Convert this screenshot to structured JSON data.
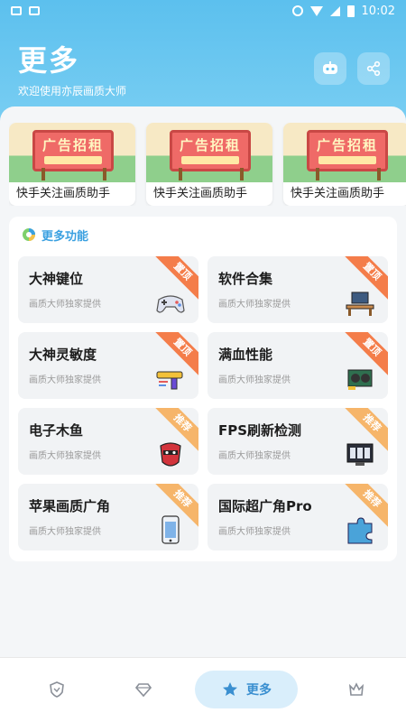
{
  "status_bar": {
    "time": "10:02"
  },
  "header": {
    "title": "更多",
    "subtitle": "欢迎使用亦辰画质大师"
  },
  "banners": [
    {
      "sign": "广告招租",
      "caption": "快手关注画质助手"
    },
    {
      "sign": "广告招租",
      "caption": "快手关注画质助手"
    },
    {
      "sign": "广告招租",
      "caption": "快手关注画质助手"
    }
  ],
  "more_section": {
    "title": "更多功能",
    "items": [
      {
        "title": "大神键位",
        "subtitle": "画质大师独家提供",
        "tag": "置顶",
        "icon": "gamepad-icon"
      },
      {
        "title": "软件合集",
        "subtitle": "画质大师独家提供",
        "tag": "置顶",
        "icon": "desk-icon"
      },
      {
        "title": "大神灵敏度",
        "subtitle": "画质大师独家提供",
        "tag": "置顶",
        "icon": "gun-icon"
      },
      {
        "title": "满血性能",
        "subtitle": "画质大师独家提供",
        "tag": "置顶",
        "icon": "gpu-icon"
      },
      {
        "title": "电子木鱼",
        "subtitle": "画质大师独家提供",
        "tag": "推荐",
        "icon": "mask-icon"
      },
      {
        "title": "FPS刷新检测",
        "subtitle": "画质大师独家提供",
        "tag": "推荐",
        "icon": "monitor-icon"
      },
      {
        "title": "苹果画质广角",
        "subtitle": "画质大师独家提供",
        "tag": "推荐",
        "icon": "phone-icon"
      },
      {
        "title": "国际超广角Pro",
        "subtitle": "画质大师独家提供",
        "tag": "推荐",
        "icon": "puzzle-icon"
      }
    ]
  },
  "bottom_nav": {
    "active_label": "更多"
  },
  "colors": {
    "header": "#5cc0ee",
    "accent": "#3aa0e0",
    "tag_hot": "#f47d4a",
    "tag_recommend": "#f6b56a"
  }
}
